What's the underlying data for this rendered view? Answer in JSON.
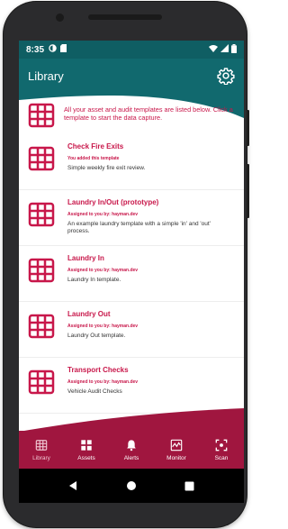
{
  "status_bar": {
    "time": "8:35"
  },
  "app_bar": {
    "title": "Library"
  },
  "intro": {
    "text": "All your asset and audit templates are listed below. Click a template to start the data capture."
  },
  "templates": [
    {
      "name": "Check Fire Exits",
      "meta": "You added this template",
      "description": "Simple weekly fire exit review."
    },
    {
      "name": "Laundry In/Out (prototype)",
      "meta": "Assigned to you by: hayman.dev",
      "description": "An example laundry template with a simple 'in' and 'out' process."
    },
    {
      "name": "Laundry In",
      "meta": "Assigned to you by: hayman.dev",
      "description": "Laundry In template."
    },
    {
      "name": "Laundry Out",
      "meta": "Assigned to you by: hayman.dev",
      "description": "Laundry Out template."
    },
    {
      "name": "Transport Checks",
      "meta": "Assigned to you by: hayman.dev",
      "description": "Vehicle Audit Checks"
    }
  ],
  "bottom_nav": [
    {
      "label": "Library",
      "icon": "library-icon",
      "active": true
    },
    {
      "label": "Assets",
      "icon": "assets-icon"
    },
    {
      "label": "Alerts",
      "icon": "bell-icon"
    },
    {
      "label": "Monitor",
      "icon": "monitor-icon"
    },
    {
      "label": "Scan",
      "icon": "scan-icon"
    }
  ],
  "colors": {
    "primary": "#11696e",
    "accent": "#c8174a",
    "nav": "#a0163f"
  }
}
